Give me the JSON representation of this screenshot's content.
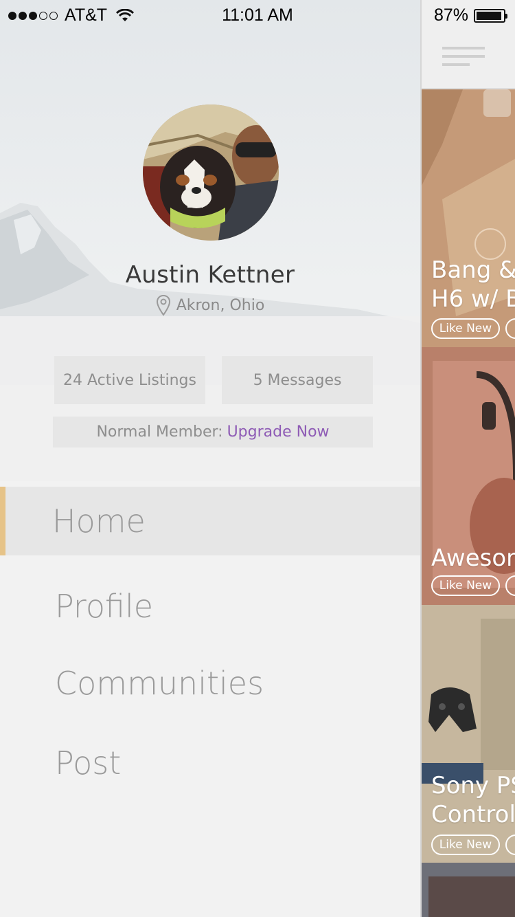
{
  "status_bar": {
    "carrier": "AT&T",
    "time": "11:01 AM",
    "battery": "87%",
    "battery_level": 0.87,
    "signal_bars": 3
  },
  "profile": {
    "name": "Austin Kettner",
    "location": "Akron, Ohio",
    "active_listings": "24 Active Listings",
    "messages": "5 Messages",
    "member_status": "Normal Member:",
    "upgrade_label": "Upgrade Now"
  },
  "nav": {
    "items": [
      {
        "label": "Home",
        "active": true
      },
      {
        "label": "Profile",
        "active": false
      },
      {
        "label": "Communities",
        "active": false
      },
      {
        "label": "Post",
        "active": false
      }
    ]
  },
  "feed": {
    "menu_icon": "hamburger-icon",
    "cards": [
      {
        "title_line1": "Bang &",
        "title_line2": "H6 w/ B",
        "tag": "Like New"
      },
      {
        "title_line1": "Aweson",
        "tag": "Like New"
      },
      {
        "title_line1": "Sony PS",
        "title_line2": "Controll",
        "tag": "Like New"
      }
    ]
  },
  "colors": {
    "accent_gold": "#e6c388",
    "upgrade_purple": "#8e5bb5"
  }
}
